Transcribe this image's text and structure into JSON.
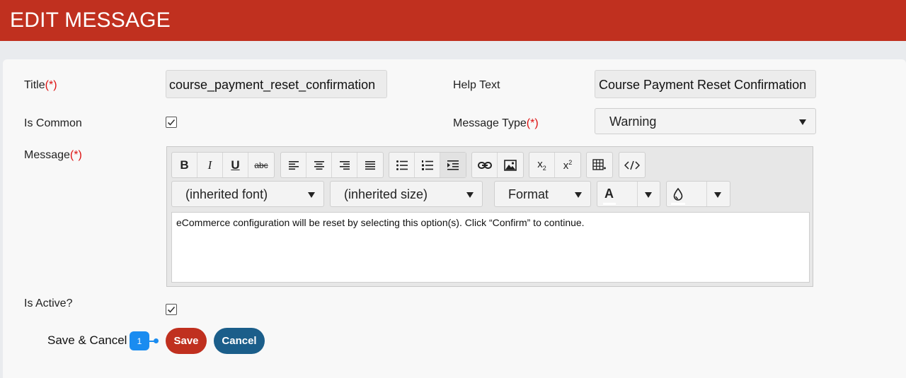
{
  "header": {
    "title": "EDIT MESSAGE"
  },
  "form": {
    "title_label": "Title",
    "help_text_label": "Help Text",
    "is_common_label": "Is Common",
    "message_type_label": "Message Type",
    "message_label": "Message",
    "is_active_label": "Is Active?",
    "required_marker": "(*)",
    "title_value": "course_payment_reset_confirmation",
    "help_text_value": "Course Payment Reset Confirmation",
    "message_type_value": "Warning",
    "is_common_checked": true,
    "is_active_checked": true
  },
  "editor": {
    "font_value": "(inherited font)",
    "size_value": "(inherited size)",
    "format_value": "Format",
    "content": "eCommerce configuration will be reset by selecting this option(s). Click “Confirm” to continue.",
    "toolbar": {
      "bold": "B",
      "italic": "I",
      "underline": "U",
      "strike": "abc",
      "text_color_glyph": "A"
    }
  },
  "actions": {
    "annotation_label": "Save & Cancel",
    "badge": "1",
    "save_label": "Save",
    "cancel_label": "Cancel"
  },
  "colors": {
    "header": "#c0301f",
    "save_button": "#c0301f",
    "cancel_button": "#1b5e8a",
    "badge": "#1a8cf0",
    "required": "#dd1111"
  }
}
